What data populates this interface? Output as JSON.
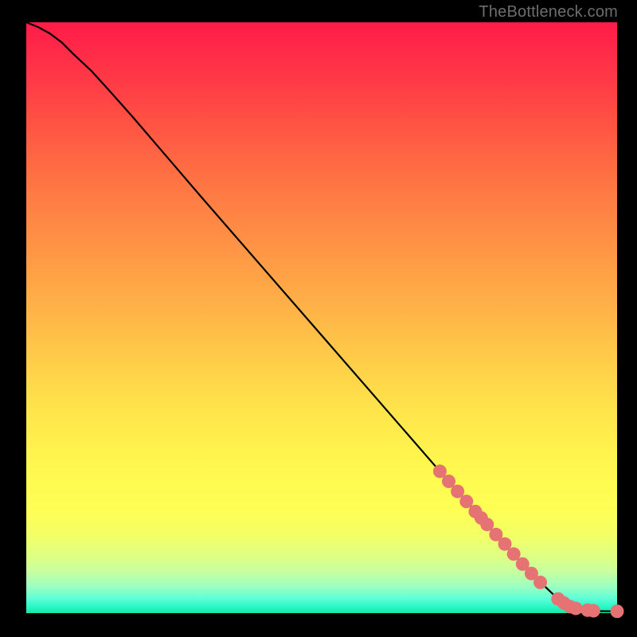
{
  "attribution_label": "TheBottleneck.com",
  "colors": {
    "marker_fill": "#e57373",
    "marker_stroke": "#c05858",
    "line_stroke": "#000000",
    "bg_top": "#ff1b49",
    "bg_bottom": "#16e8a6"
  },
  "chart_data": {
    "type": "line",
    "title": "",
    "xlabel": "",
    "ylabel": "",
    "xlim": [
      0,
      100
    ],
    "ylim": [
      0,
      100
    ],
    "series": [
      {
        "name": "curve",
        "x": [
          0,
          2,
          4,
          6,
          8,
          11,
          14,
          18,
          24,
          30,
          40,
          50,
          60,
          70,
          78,
          82,
          85,
          88,
          90,
          91.5,
          93,
          94,
          95,
          100
        ],
        "y": [
          100,
          99.2,
          98.1,
          96.6,
          94.6,
          91.8,
          88.5,
          84,
          77,
          70,
          58.5,
          47,
          35.5,
          24,
          15,
          10.5,
          7.2,
          4.3,
          2.4,
          1.4,
          0.8,
          0.5,
          0.35,
          0.3
        ]
      }
    ],
    "markers": {
      "name": "highlighted-points",
      "x": [
        70,
        71.5,
        73,
        74.5,
        76,
        77,
        78,
        79.5,
        81,
        82.5,
        84,
        85.5,
        87,
        90,
        91,
        92,
        93,
        95,
        96,
        100
      ],
      "y": [
        24,
        22.3,
        20.6,
        18.9,
        17.2,
        16.1,
        15,
        13.3,
        11.7,
        10,
        8.3,
        6.7,
        5.2,
        2.4,
        1.7,
        1.1,
        0.8,
        0.5,
        0.4,
        0.3
      ]
    }
  }
}
